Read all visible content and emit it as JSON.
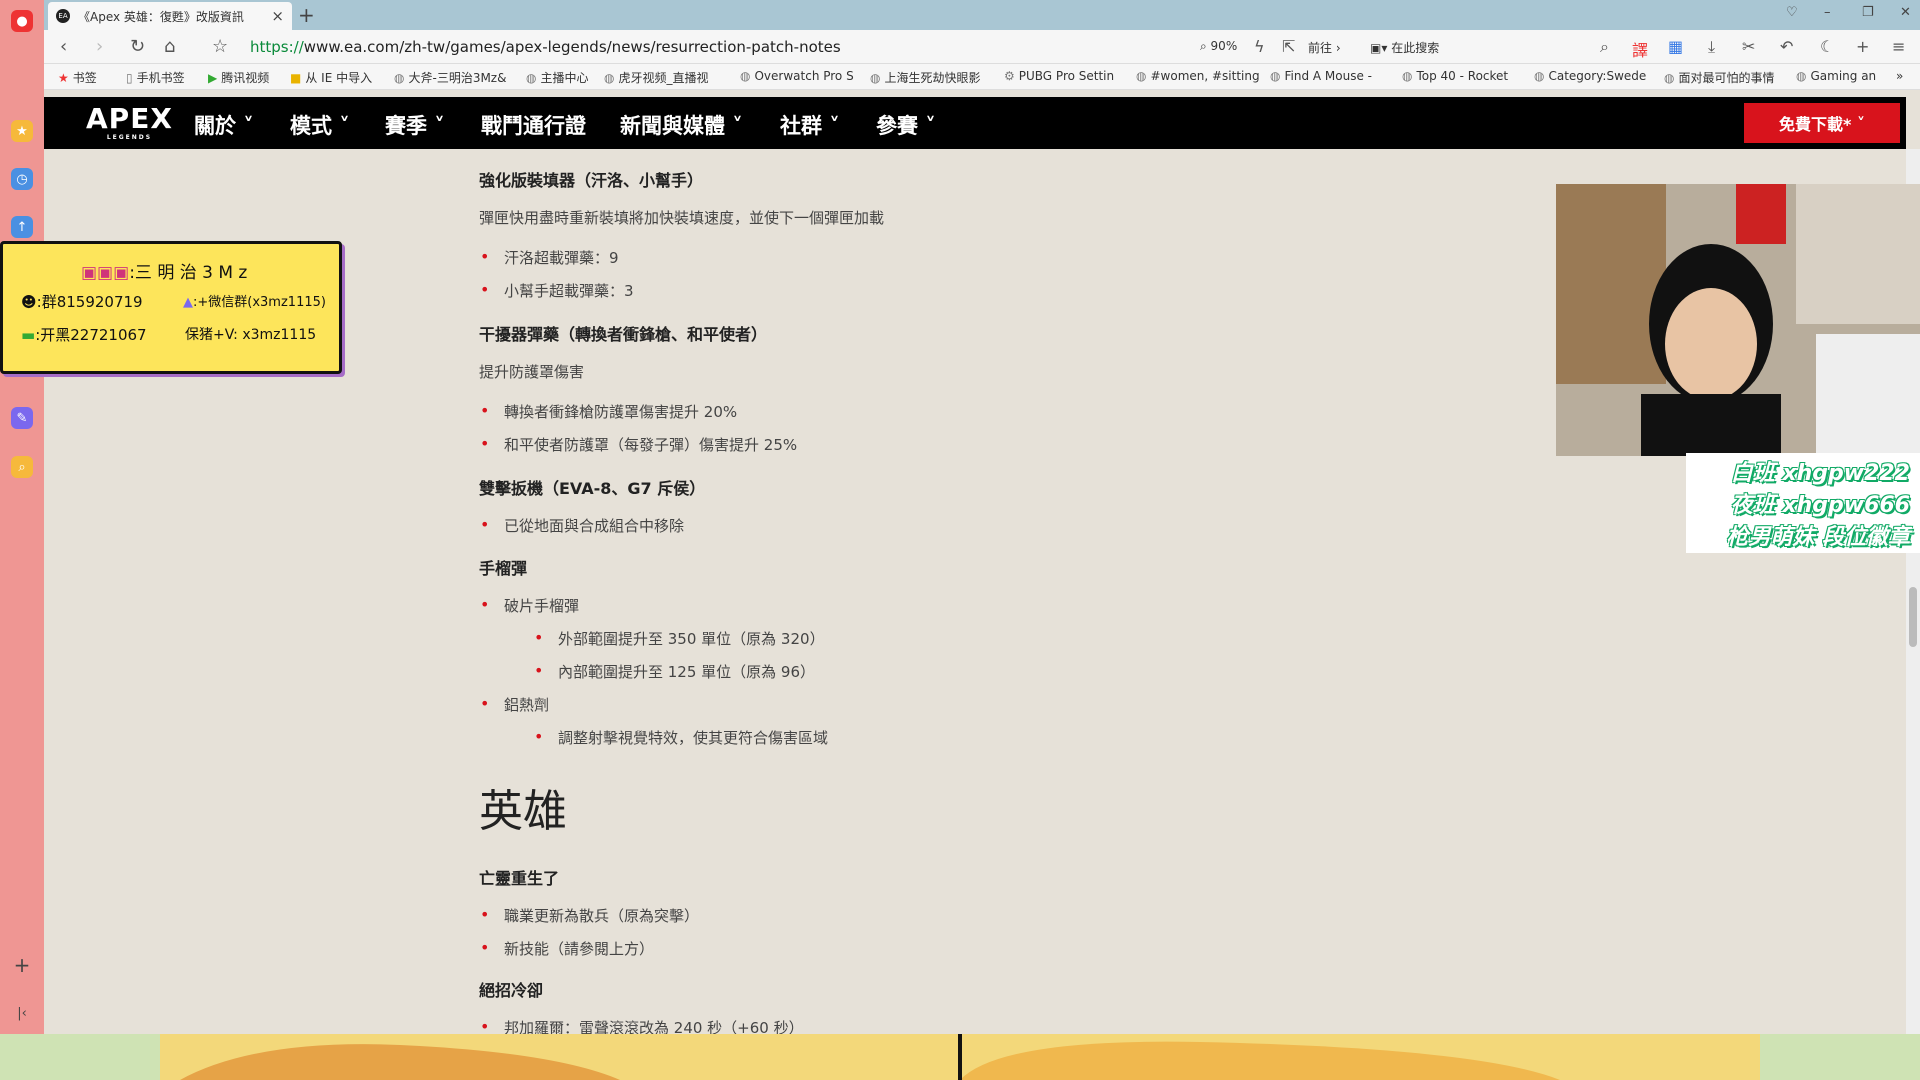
{
  "browser": {
    "tab_title": "《Apex 英雄：復甦》改版資訊",
    "tab_favicon": "EA",
    "url_scheme": "https://",
    "url_rest": "www.ea.com/zh-tw/games/apex-legends/news/resurrection-patch-notes",
    "zoom": "90%",
    "goto_label": "前往",
    "search_label": "在此搜索"
  },
  "bookmarks": [
    {
      "label": "书签",
      "icon": "star-icon"
    },
    {
      "label": "手机书签",
      "icon": "phone-icon"
    },
    {
      "label": "腾讯视频",
      "icon": "play-icon"
    },
    {
      "label": "从 IE 中导入",
      "icon": "folder-icon"
    },
    {
      "label": "大斧-三明治3Mz&",
      "icon": "globe-icon"
    },
    {
      "label": "主播中心",
      "icon": "globe-icon"
    },
    {
      "label": "虎牙视频_直播视",
      "icon": "globe-icon"
    },
    {
      "label": "Overwatch Pro S",
      "icon": "globe-icon"
    },
    {
      "label": "上海生死劫快眼影",
      "icon": "globe-icon"
    },
    {
      "label": "PUBG Pro Settin",
      "icon": "gear-icon"
    },
    {
      "label": "#women, #sitting",
      "icon": "globe-icon"
    },
    {
      "label": "Find A Mouse - ",
      "icon": "globe-icon"
    },
    {
      "label": "Top 40 - Rocket",
      "icon": "globe-icon"
    },
    {
      "label": "Category:Swede",
      "icon": "globe-icon"
    },
    {
      "label": "面对最可怕的事情",
      "icon": "globe-icon"
    },
    {
      "label": "Gaming an",
      "icon": "globe-icon"
    }
  ],
  "site_nav": {
    "logo": "APEX",
    "logo_sub": "LEGENDS",
    "items": [
      "關於",
      "模式",
      "賽季",
      "戰鬥通行證",
      "新聞與媒體",
      "社群",
      "參賽"
    ],
    "download": "免費下載*"
  },
  "content": {
    "s1_title": "強化版裝填器（汗洛、小幫手）",
    "s1_desc": "彈匣快用盡時重新裝填將加快裝填速度，並使下一個彈匣加載",
    "s1_b1": "汗洛超載彈藥：9",
    "s1_b2": "小幫手超載彈藥：3",
    "s2_title": "干擾器彈藥（轉換者衝鋒槍、和平使者）",
    "s2_desc": "提升防護罩傷害",
    "s2_b1": "轉換者衝鋒槍防護罩傷害提升 20%",
    "s2_b2": "和平使者防護罩（每發子彈）傷害提升 25%",
    "s3_title": "雙擊扳機（EVA-8、G7 斥侯）",
    "s3_b1": "已從地面與合成組合中移除",
    "s4_title": "手榴彈",
    "s4_b1": "破片手榴彈",
    "s4_b1a": "外部範圍提升至 350 單位（原為 320）",
    "s4_b1b": "內部範圍提升至 125 單位（原為 96）",
    "s4_b2": "鋁熱劑",
    "s4_b2a": "調整射擊視覺特效，使其更符合傷害區域",
    "heroes": "英雄",
    "h1_title": "亡靈重生了",
    "h1_b1": "職業更新為散兵（原為突擊）",
    "h1_b2": "新技能（請參閱上方）",
    "h2_title": "絕招冷卻",
    "h2_b1": "邦加羅爾：雷聲滾滾改為 240 秒（+60 秒）"
  },
  "stream_note": {
    "line1": ":三 明 治 3 M z",
    "line2a": ":群815920719",
    "line2b": ":+微信群(x3mz1115)",
    "line3a": ":开黑22721067",
    "line3b": "保猪+V: x3mz1115"
  },
  "stream_overlay": {
    "line1": "白班 xhgpw222",
    "line2": "夜班 xhgpw666",
    "line3": "枪男萌妹 段位徽章"
  },
  "colors": {
    "accent": "#d8131c",
    "page_bg": "#e6e1d8",
    "sidebar": "#ef9693"
  }
}
